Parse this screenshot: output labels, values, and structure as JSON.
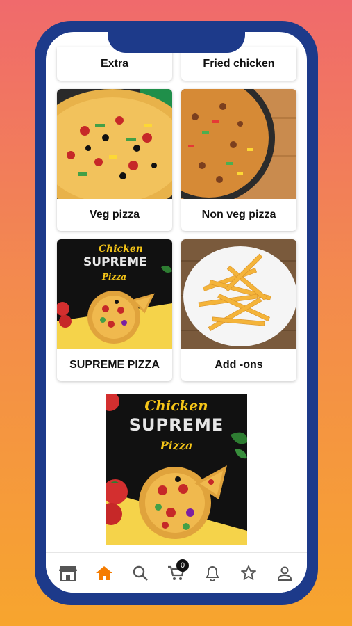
{
  "categories": [
    {
      "label": "Extra"
    },
    {
      "label": "Fried chicken"
    },
    {
      "label": "Veg pizza"
    },
    {
      "label": "Non veg pizza"
    },
    {
      "label": "SUPREME PIZZA"
    },
    {
      "label": "Add -ons"
    }
  ],
  "promo": {
    "line1": "Chicken",
    "line2": "SUPREME",
    "line3": "Pizza"
  },
  "nav": {
    "items": [
      "store-icon",
      "home-icon",
      "search-icon",
      "cart-icon",
      "bell-icon",
      "star-icon",
      "user-icon"
    ],
    "active": "home-icon",
    "cart_count": "0"
  },
  "colors": {
    "phone_frame": "#1d3a8a",
    "active_nav": "#f57c00",
    "inactive_nav": "#555555"
  }
}
